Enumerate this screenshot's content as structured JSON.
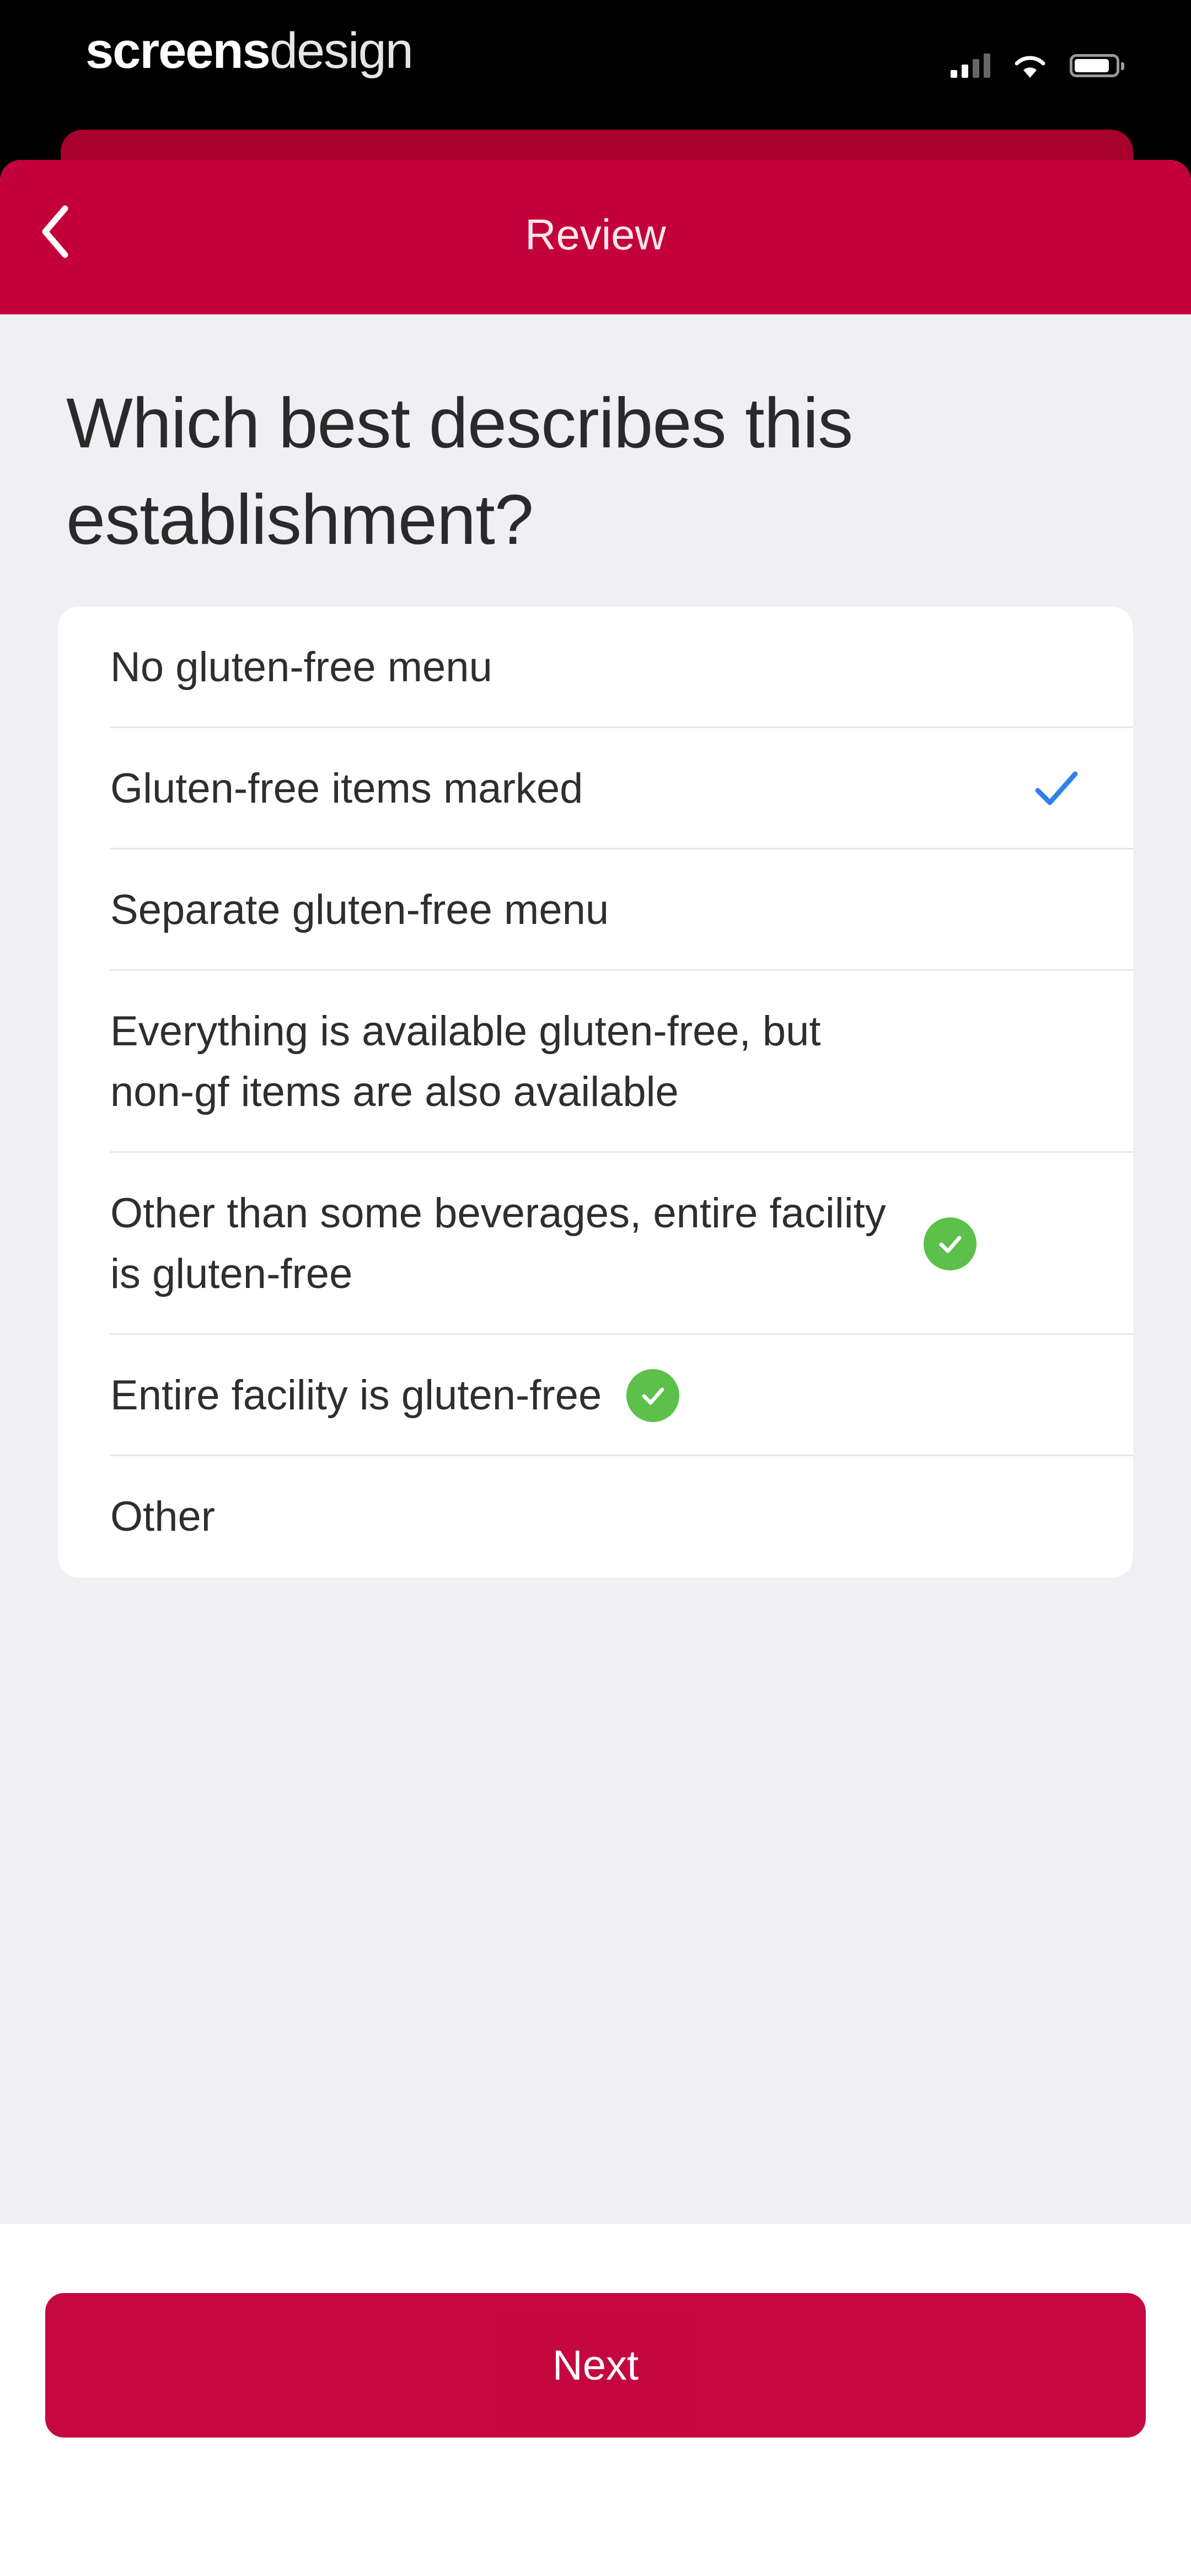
{
  "watermark": {
    "bold": "screens",
    "light": "design"
  },
  "status_bar": {
    "icons": [
      "signal-icon",
      "wifi-icon",
      "battery-icon"
    ]
  },
  "nav": {
    "title": "Review",
    "back_icon": "chevron-left-icon"
  },
  "question": "Which best describes this establishment?",
  "options": [
    {
      "label": "No gluten-free menu",
      "selected": false,
      "badge": false
    },
    {
      "label": "Gluten-free items marked",
      "selected": true,
      "badge": false
    },
    {
      "label": "Separate gluten-free menu",
      "selected": false,
      "badge": false
    },
    {
      "label": "Everything is available gluten-free, but non-gf items are also available",
      "selected": false,
      "badge": false
    },
    {
      "label": "Other than some beverages, entire facility is gluten-free",
      "selected": false,
      "badge": true
    },
    {
      "label": "Entire facility is gluten-free",
      "selected": false,
      "badge": true
    },
    {
      "label": "Other",
      "selected": false,
      "badge": false
    }
  ],
  "footer": {
    "next_label": "Next"
  },
  "colors": {
    "brand": "#c4003a",
    "brand_dark": "#a8002c",
    "background": "#efeff4",
    "check_blue": "#2f80ed",
    "badge_green": "#5cc04a"
  }
}
